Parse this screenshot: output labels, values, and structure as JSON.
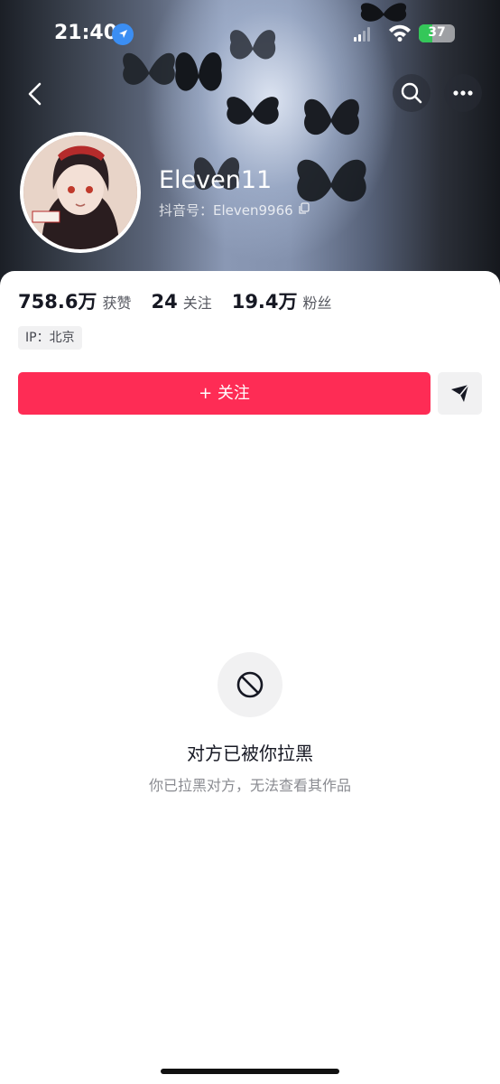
{
  "status_bar": {
    "time": "21:40",
    "battery": "37",
    "battery_level": 0.37,
    "icons": [
      "location-arrow-icon",
      "cellular-signal-icon",
      "wifi-icon",
      "battery-icon"
    ]
  },
  "header": {
    "icons": [
      "back-arrow-icon",
      "search-icon",
      "more-icon"
    ]
  },
  "profile": {
    "username": "Eleven11",
    "douyin_id": "抖音号：Eleven9966",
    "avatar_icon": "avatar-image",
    "copy_icon": "copy-icon"
  },
  "stats": [
    {
      "value": "758.6万",
      "label": "获赞"
    },
    {
      "value": "24",
      "label": "关注"
    },
    {
      "value": "19.4万",
      "label": "粉丝"
    }
  ],
  "ip": "IP：北京",
  "actions": {
    "follow_label": "+ 关注",
    "message_icon": "send-message-icon"
  },
  "blocked": {
    "icon": "block-icon",
    "title": "对方已被你拉黑",
    "subtitle": "你已拉黑对方，无法查看其作品"
  },
  "colors": {
    "accent": "#fe2c55",
    "text_primary": "#161823",
    "text_secondary": "#8a8b91"
  }
}
